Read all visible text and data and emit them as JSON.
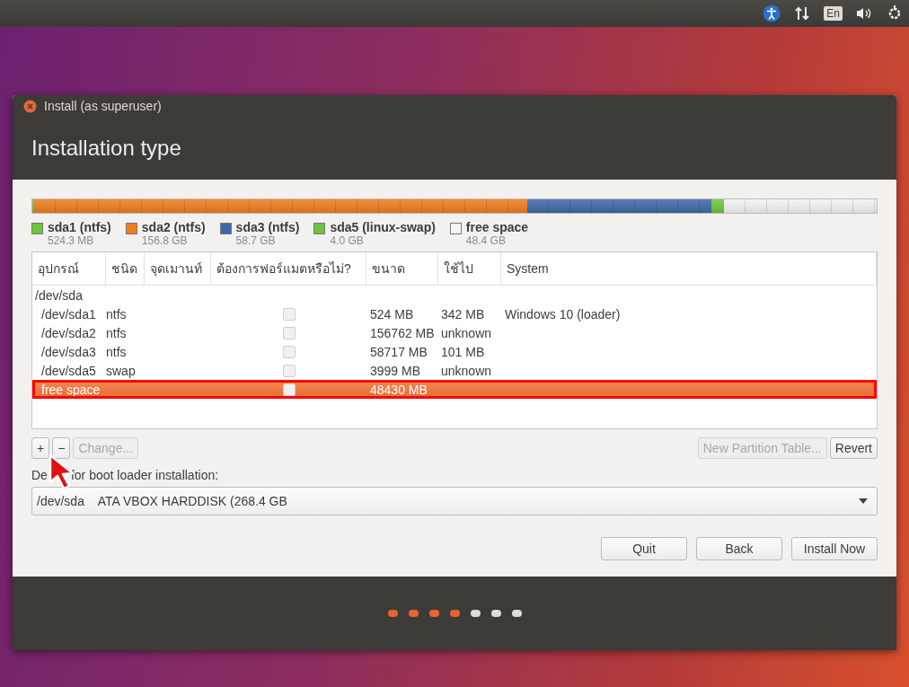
{
  "top_panel": {
    "keyboard_layout": "En"
  },
  "window": {
    "title": "Install (as superuser)",
    "heading": "Installation type"
  },
  "partitions": [
    {
      "name": "sda1 (ntfs)",
      "size": "524.3 MB",
      "color": "#6cc63a"
    },
    {
      "name": "sda2 (ntfs)",
      "size": "156.8 GB",
      "color": "#f07d1e"
    },
    {
      "name": "sda3 (ntfs)",
      "size": "58.7 GB",
      "color": "#3f68a8"
    },
    {
      "name": "sda5 (linux-swap)",
      "size": "4.0 GB",
      "color": "#6cc63a"
    },
    {
      "name": "free space",
      "size": "48.4 GB",
      "color": "#f4f4f4"
    }
  ],
  "table": {
    "columns": [
      "อุปกรณ์",
      "ชนิด",
      "จุดเมานท์",
      "ต้องการฟอร์แมตหรือไม่?",
      "ขนาด",
      "ใช้ไป",
      "System"
    ],
    "rows": [
      {
        "device": "/dev/sda",
        "selected": false,
        "children": [
          {
            "device": "/dev/sda1",
            "type": "ntfs",
            "format": false,
            "size": "524 MB",
            "used": "342 MB",
            "system": "Windows 10 (loader)",
            "selected": false
          },
          {
            "device": "/dev/sda2",
            "type": "ntfs",
            "format": false,
            "size": "156762 MB",
            "used": "unknown",
            "selected": false
          },
          {
            "device": "/dev/sda3",
            "type": "ntfs",
            "format": false,
            "size": "58717 MB",
            "used": "101 MB",
            "selected": false
          },
          {
            "device": "/dev/sda5",
            "type": "swap",
            "format": false,
            "size": "3999 MB",
            "used": "unknown",
            "selected": false
          },
          {
            "device": "free space",
            "format": false,
            "size": "48430 MB",
            "selected": true
          }
        ]
      }
    ]
  },
  "table_buttons": [
    {
      "label": "+",
      "disabled": false
    },
    {
      "label": "−",
      "disabled": false
    },
    {
      "label": "Change...",
      "disabled": true
    }
  ],
  "table_buttons_right": [
    {
      "label": "New Partition Table...",
      "disabled": true
    },
    {
      "label": "Revert",
      "disabled": false
    }
  ],
  "boot_loader": {
    "label_parts": [
      "De",
      "for boot loader installation:"
    ],
    "value": "/dev/sda    ATA VBOX HARDDISK (268.4 GB"
  },
  "buttons": [
    "Quit",
    "Back",
    "Install Now"
  ],
  "progress_dots": [
    {
      "done": true
    },
    {
      "done": true
    },
    {
      "done": true
    },
    {
      "done": true
    },
    {
      "done": false
    },
    {
      "done": false
    },
    {
      "done": false
    }
  ]
}
